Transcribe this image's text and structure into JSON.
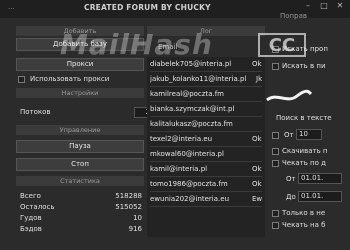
{
  "titlebar": {
    "app_title": "...",
    "banner": "CREATED FORUM BY CHUCKY",
    "help": "Поправ"
  },
  "window_controls": {
    "minimize": "–",
    "maximize": "□",
    "close": "✕"
  },
  "left": {
    "sections": {
      "add": "Добавить",
      "settings": "Настройки",
      "control": "Управление",
      "stats": "Статистика"
    },
    "buttons": {
      "add_base": "Добавить базу",
      "proxies": "Прокси",
      "pause": "Пауза",
      "stop": "Стоп"
    },
    "use_proxies_label": "Использовать прокси",
    "threads_label": "Потоков",
    "threads_value": "200",
    "stats": [
      {
        "label": "Всего",
        "value": "518288"
      },
      {
        "label": "Осталось",
        "value": "515052"
      },
      {
        "label": "Гудов",
        "value": "10"
      },
      {
        "label": "Бэдов",
        "value": "916"
      }
    ]
  },
  "middle": {
    "section_log": "Лог",
    "header_email": "Email",
    "emails": [
      "diabelek705@interia.pl",
      "jakub_kolanko11@interia.pl",
      "kamilreal@poczta.fm",
      "bianka.szymczak@int.pl",
      "kalitalukasz@poczta.fm",
      "texel2@interia.eu",
      "mkowal60@interia.pl",
      "kamil@interia.pl",
      "tomo1986@poczta.fm",
      "ewunia202@interia.eu"
    ],
    "second_col": [
      "Ok",
      "Jk",
      "",
      "",
      "",
      "Ok",
      "",
      "Ok",
      "Ok",
      "Ew"
    ]
  },
  "right": {
    "check_label": "Искать проп",
    "check2_label": "Искать в пи",
    "search_text_label": "Поиск в тексте",
    "from_label": "От",
    "from_value": "10",
    "download_label": "Скачивать п",
    "print_label": "Чекать по д",
    "from2_label": "От",
    "from2_value": "01.01.",
    "to_label": "До",
    "to_value": "01.01.",
    "only_new_label": "Только в не",
    "check_last_label": "Чекать на б"
  },
  "overlay": {
    "watermark": "MailHash",
    "badge": "CC"
  }
}
